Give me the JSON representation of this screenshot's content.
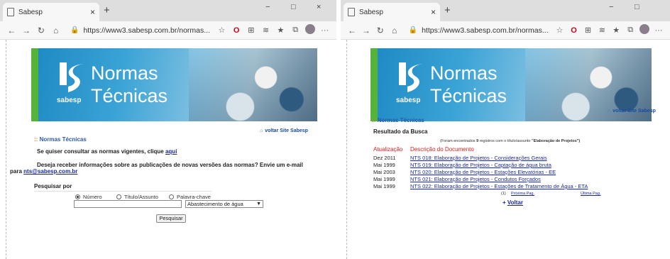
{
  "left": {
    "tab_title": "Sabesp",
    "url": "https://www3.sabesp.com.br/normas...",
    "banner": {
      "title_line1": "Normas",
      "title_line2": "Técnicas",
      "brand": "sabesp"
    },
    "voltar_site": "voltar Site Sabesp",
    "section_title": "Normas Técnicas",
    "consult_text": "Se quiser consultar as normas vigentes, clique",
    "consult_link": "aqui",
    "email_text": "Deseja receber informações sobre as publicações de novas versões das normas? Envie um e-mail",
    "email_para": "para",
    "email_link": "nts@sabesp.com.br",
    "search_label": "Pesquisar por",
    "radio_options": [
      "Número",
      "Título/Assunto",
      "Palavra-chave"
    ],
    "selected_radio": "Número",
    "select_value": "Abastecimento de água",
    "search_button": "Pesquisar"
  },
  "right": {
    "tab_title": "Sabesp",
    "url": "https://www3.sabesp.com.br/normas...",
    "banner": {
      "title_line1": "Normas",
      "title_line2": "Técnicas",
      "brand": "sabesp"
    },
    "voltar_site": "voltar Site Sabesp",
    "section_title": "Normas Técnicas",
    "result_title": "Resultado da Busca",
    "found_prefix": "(Foram encontrados",
    "found_count": "9",
    "found_mid": "registros com o título/assunto",
    "found_query": "\"Elaboração de Projetos\")",
    "col_date": "Atualização",
    "col_desc": "Descrição do Documento",
    "rows": [
      {
        "date": "Dez 2011",
        "desc": "NTS 018: Elaboração de Projetos - Considerações Gerais"
      },
      {
        "date": "Mai 1999",
        "desc": "NTS 019: Elaboração de Projetos - Captação de água bruta"
      },
      {
        "date": "Mai 2003",
        "desc": "NTS 020: Elaboração de Projetos - Estações Elevatórias - EE"
      },
      {
        "date": "Mai 1999",
        "desc": "NTS 021: Elaboração de Projetos - Condutos Forçados"
      },
      {
        "date": "Mai 1999",
        "desc": "NTS 022: Elaboração de Projetos - Estações de Tratamento de Água - ETA"
      }
    ],
    "pager_page": "(1)",
    "pager_next": "Próxima Pag.",
    "pager_last": "Última Pag.",
    "voltar": "Voltar"
  },
  "icons": {
    "back": "←",
    "forward": "→",
    "refresh": "↻",
    "home": "⌂",
    "lock": "🔒",
    "star": "☆",
    "opera": "O",
    "ext1": "⊞",
    "ext2": "≋",
    "favorites": "★",
    "collections": "⧉",
    "more": "···",
    "close": "×",
    "new_tab": "+",
    "minimize": "−",
    "maximize": "□"
  },
  "colors": {
    "green_stripe": "#55b33b",
    "link_blue": "#1a2a9c",
    "section_blue": "#2b5aa8",
    "red_header": "#d81e1e"
  }
}
